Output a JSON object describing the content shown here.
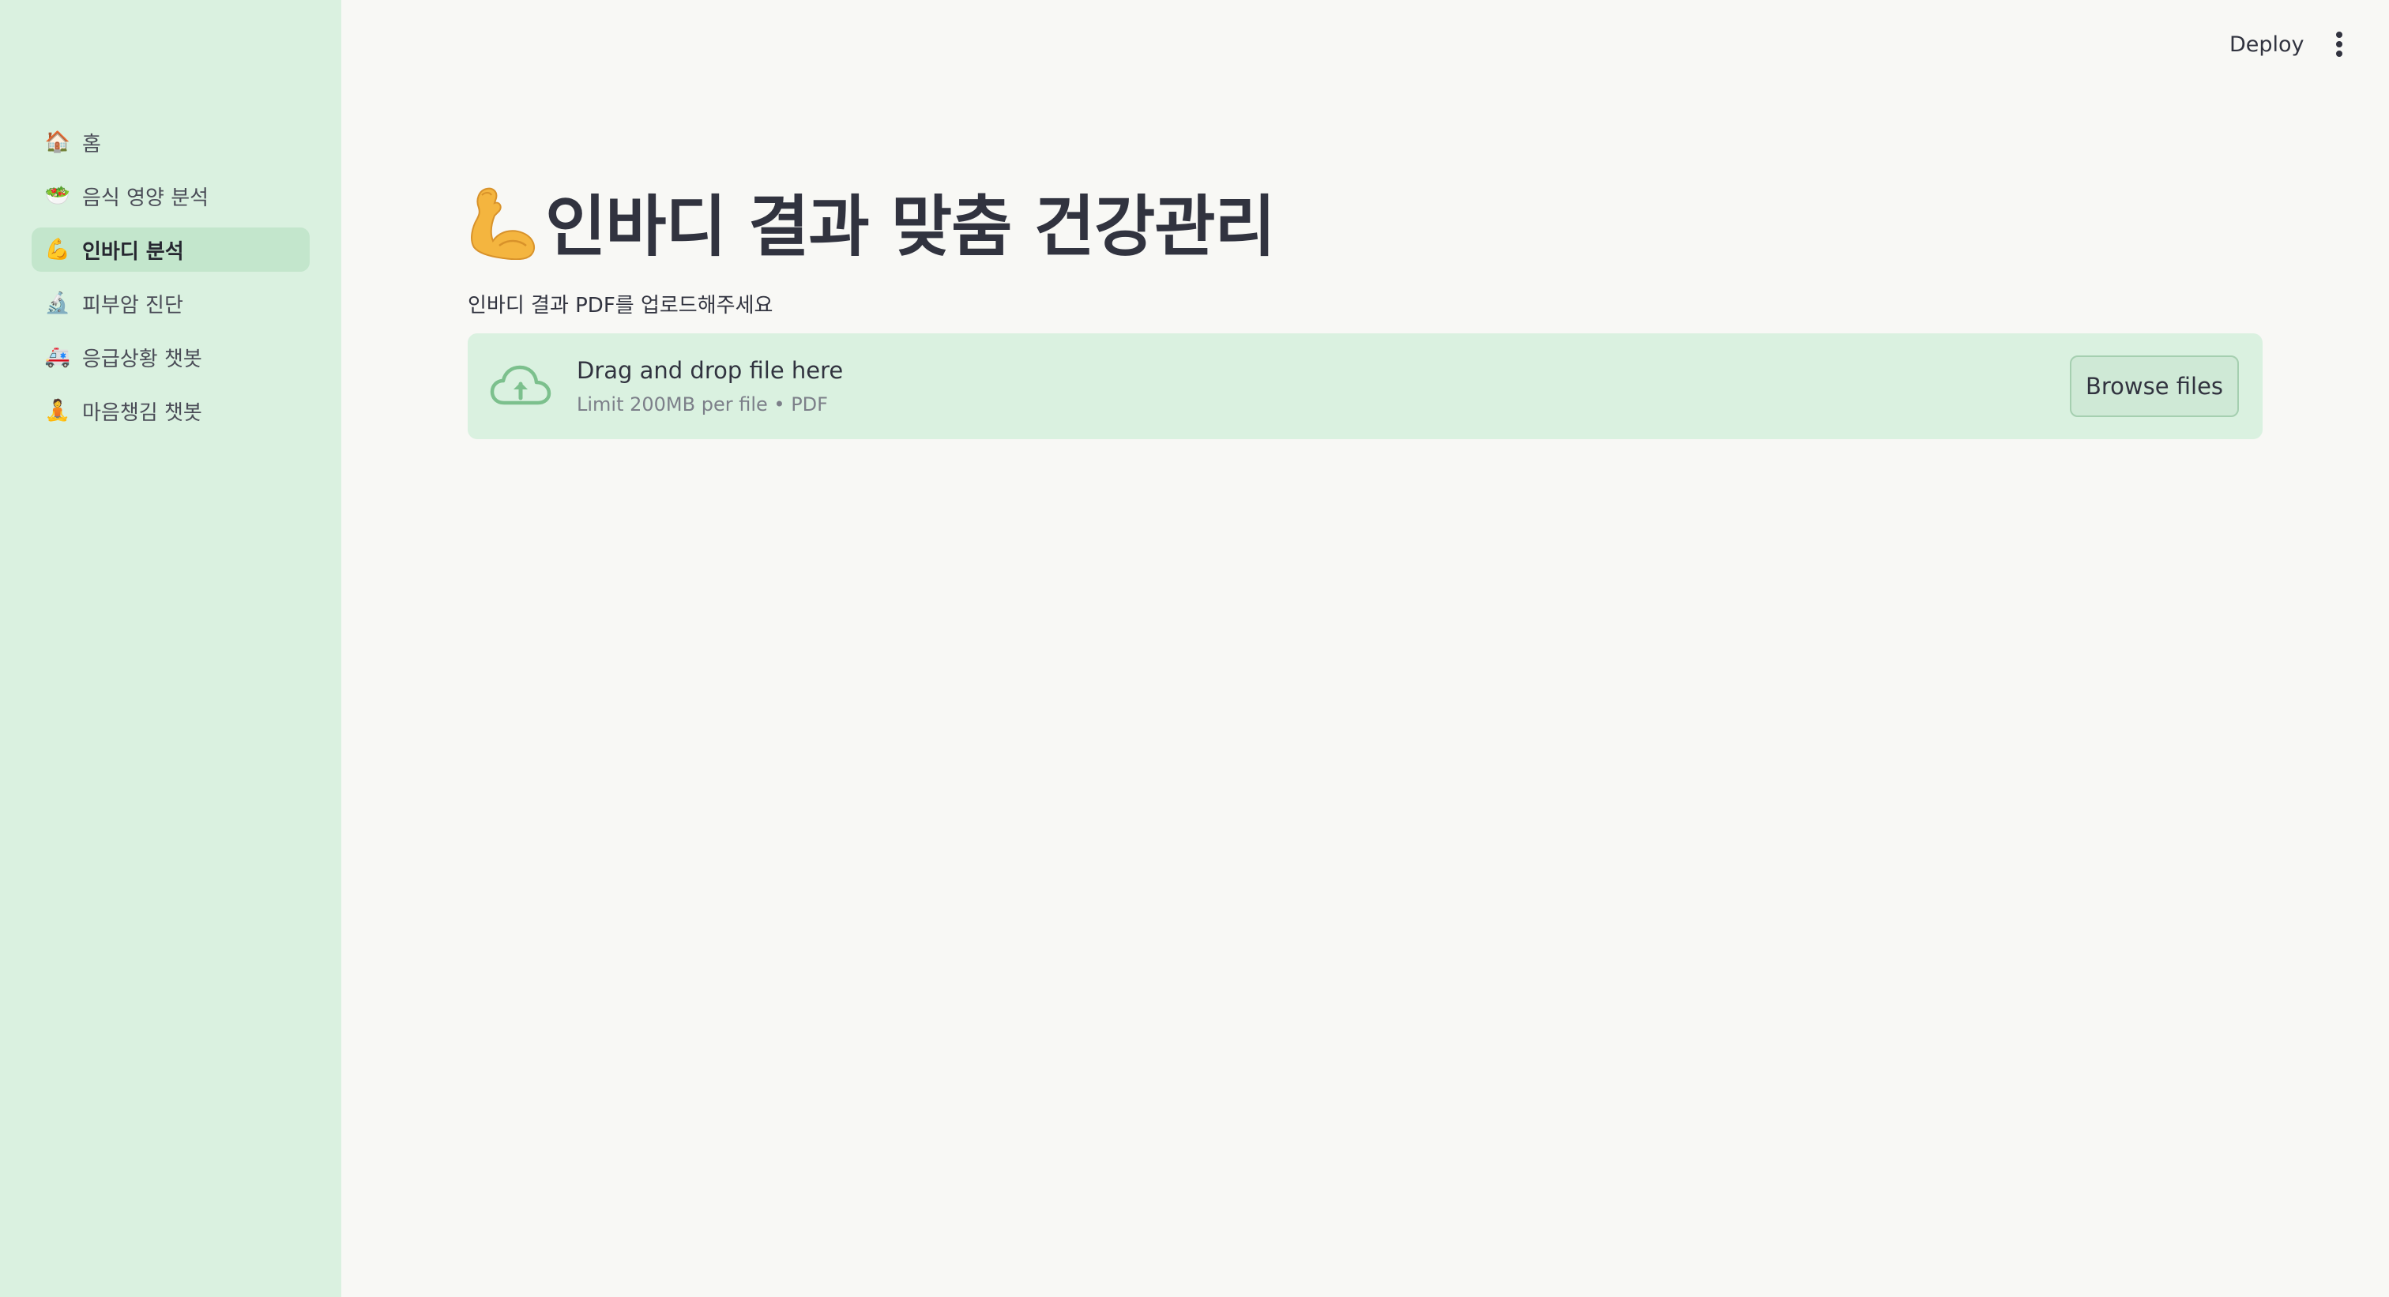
{
  "header": {
    "deploy_label": "Deploy",
    "menu_icon": "vertical-ellipsis-icon"
  },
  "sidebar": {
    "items": [
      {
        "label": "홈",
        "icon": "🏠",
        "icon_name": "house-icon",
        "active": false
      },
      {
        "label": "음식 영양 분석",
        "icon": "🥗",
        "icon_name": "salad-icon",
        "active": false
      },
      {
        "label": "인바디 분석",
        "icon": "💪",
        "icon_name": "flexed-bicep-icon",
        "active": true
      },
      {
        "label": "피부암 진단",
        "icon": "🔬",
        "icon_name": "microscope-icon",
        "active": false
      },
      {
        "label": "응급상황 챗봇",
        "icon": "🚑",
        "icon_name": "ambulance-icon",
        "active": false
      },
      {
        "label": "마음챙김 챗봇",
        "icon": "🧘",
        "icon_name": "meditation-icon",
        "active": false
      }
    ]
  },
  "main": {
    "title": "인바디 결과 맞춤 건강관리",
    "title_icon": "flexed-bicep-icon",
    "uploader": {
      "label": "인바디 결과 PDF를 업로드해주세요",
      "drop_title": "Drag and drop file here",
      "drop_subtitle": "Limit 200MB per file • PDF",
      "browse_label": "Browse files",
      "icon": "cloud-upload-icon"
    }
  },
  "colors": {
    "sidebar_bg": "#daf1e0",
    "page_bg": "#f8f8f5",
    "active_item_bg": "#c3e6cc",
    "dropzone_bg": "#daf1e0",
    "accent_green": "#7cc08d"
  }
}
